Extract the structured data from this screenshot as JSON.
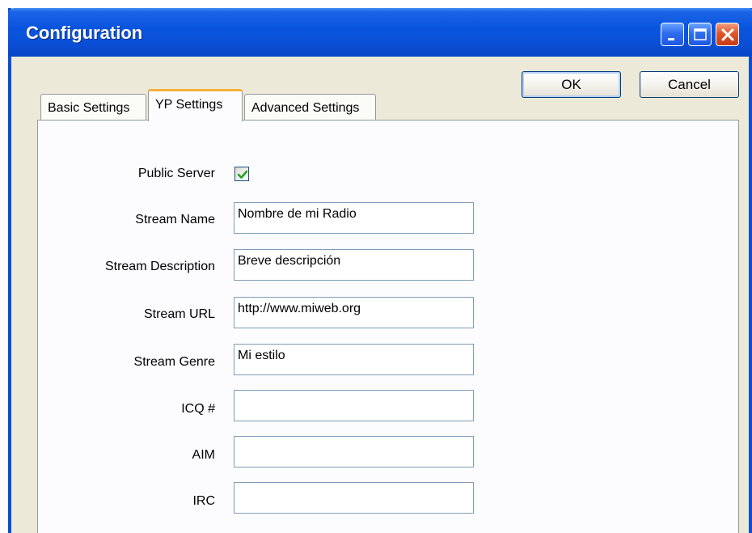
{
  "window": {
    "title": "Configuration"
  },
  "buttons": {
    "ok": "OK",
    "cancel": "Cancel"
  },
  "tabs": [
    {
      "label": "Basic Settings",
      "selected": false
    },
    {
      "label": "YP Settings",
      "selected": true
    },
    {
      "label": "Advanced Settings",
      "selected": false
    }
  ],
  "form": {
    "public_server": {
      "label": "Public Server",
      "checked": true
    },
    "stream_name": {
      "label": "Stream Name",
      "value": "Nombre de mi Radio"
    },
    "stream_description": {
      "label": "Stream Description",
      "value": "Breve descripción"
    },
    "stream_url": {
      "label": "Stream URL",
      "value": "http://www.miweb.org"
    },
    "stream_genre": {
      "label": "Stream Genre",
      "value": "Mi estilo"
    },
    "icq": {
      "label": "ICQ #",
      "value": ""
    },
    "aim": {
      "label": "AIM",
      "value": ""
    },
    "irc": {
      "label": "IRC",
      "value": ""
    }
  },
  "colors": {
    "titlebar": "#0a4fd6",
    "dialog_bg": "#ece9d8",
    "tab_highlight": "#f7b03a",
    "checkmark": "#21a121"
  }
}
